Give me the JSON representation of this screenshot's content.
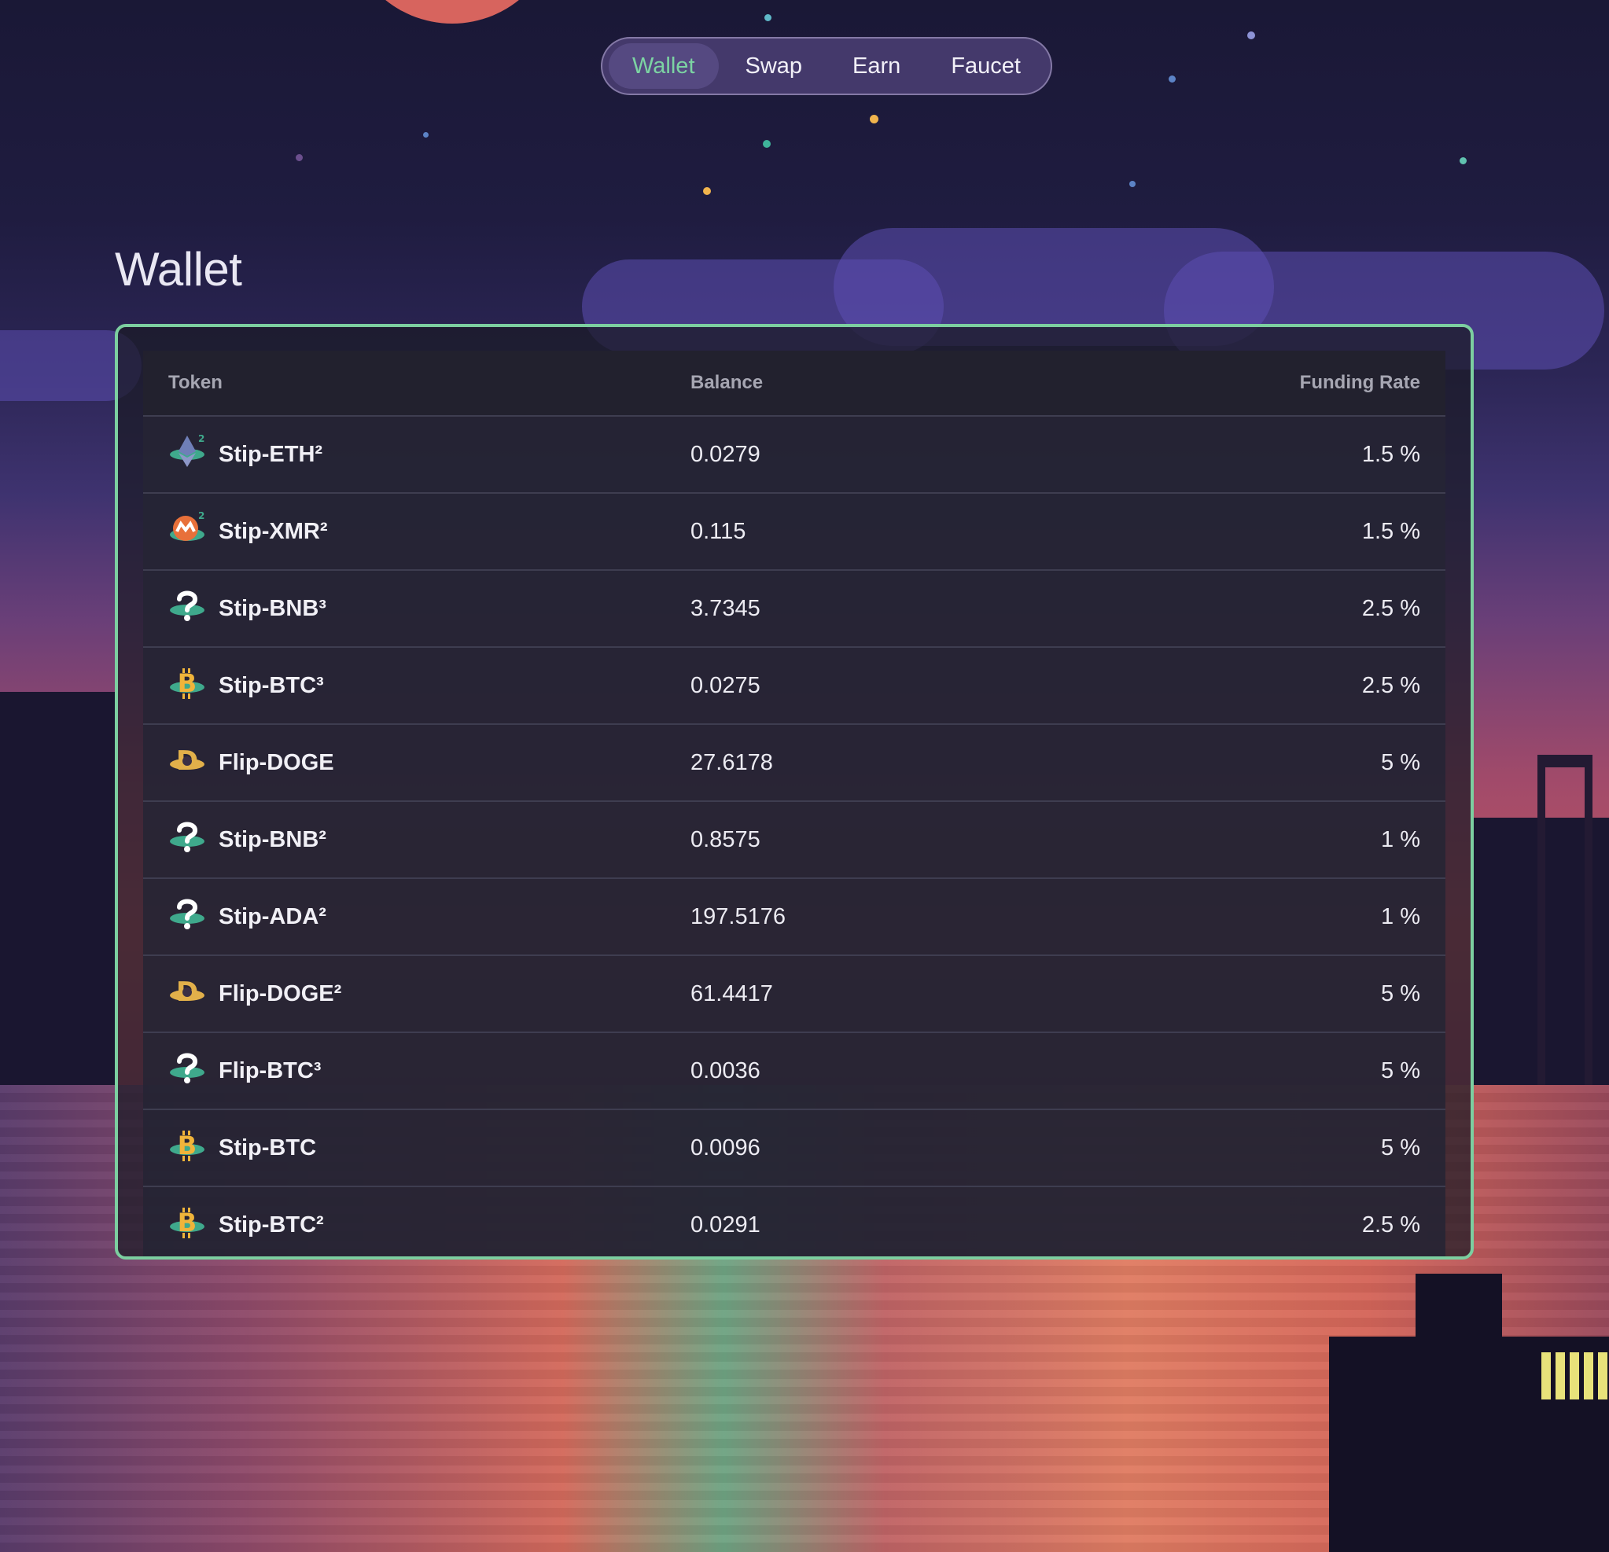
{
  "nav": {
    "items": [
      {
        "label": "Wallet",
        "active": true
      },
      {
        "label": "Swap",
        "active": false
      },
      {
        "label": "Earn",
        "active": false
      },
      {
        "label": "Faucet",
        "active": false
      }
    ]
  },
  "page": {
    "title": "Wallet"
  },
  "table": {
    "headers": {
      "token": "Token",
      "balance": "Balance",
      "rate": "Funding Rate"
    },
    "rows": [
      {
        "token": "Stip-ETH²",
        "balance": "0.0279",
        "rate": "1.5 %",
        "icon": "eth-coin-icon"
      },
      {
        "token": "Stip-XMR²",
        "balance": "0.115",
        "rate": "1.5 %",
        "icon": "xmr-coin-icon"
      },
      {
        "token": "Stip-BNB³",
        "balance": "3.7345",
        "rate": "2.5 %",
        "icon": "question-mark-coin-icon"
      },
      {
        "token": "Stip-BTC³",
        "balance": "0.0275",
        "rate": "2.5 %",
        "icon": "btc-coin-icon"
      },
      {
        "token": "Flip-DOGE",
        "balance": "27.6178",
        "rate": "5 %",
        "icon": "doge-coin-icon"
      },
      {
        "token": "Stip-BNB²",
        "balance": "0.8575",
        "rate": "1 %",
        "icon": "question-mark-coin-icon"
      },
      {
        "token": "Stip-ADA²",
        "balance": "197.5176",
        "rate": "1 %",
        "icon": "question-mark-coin-icon"
      },
      {
        "token": "Flip-DOGE²",
        "balance": "61.4417",
        "rate": "5 %",
        "icon": "doge-coin-icon"
      },
      {
        "token": "Flip-BTC³",
        "balance": "0.0036",
        "rate": "5 %",
        "icon": "question-mark-coin-icon"
      },
      {
        "token": "Stip-BTC",
        "balance": "0.0096",
        "rate": "5 %",
        "icon": "btc-coin-icon"
      },
      {
        "token": "Stip-BTC²",
        "balance": "0.0291",
        "rate": "2.5 %",
        "icon": "btc-coin-icon"
      }
    ]
  },
  "colors": {
    "accent": "#7ccfa0",
    "nav_active": "#7cd3a3",
    "eth": "#6f7fb8",
    "xmr": "#e8703a",
    "btc": "#f0b43a",
    "doge": "#e2b04a",
    "teal": "#3fa98c"
  }
}
